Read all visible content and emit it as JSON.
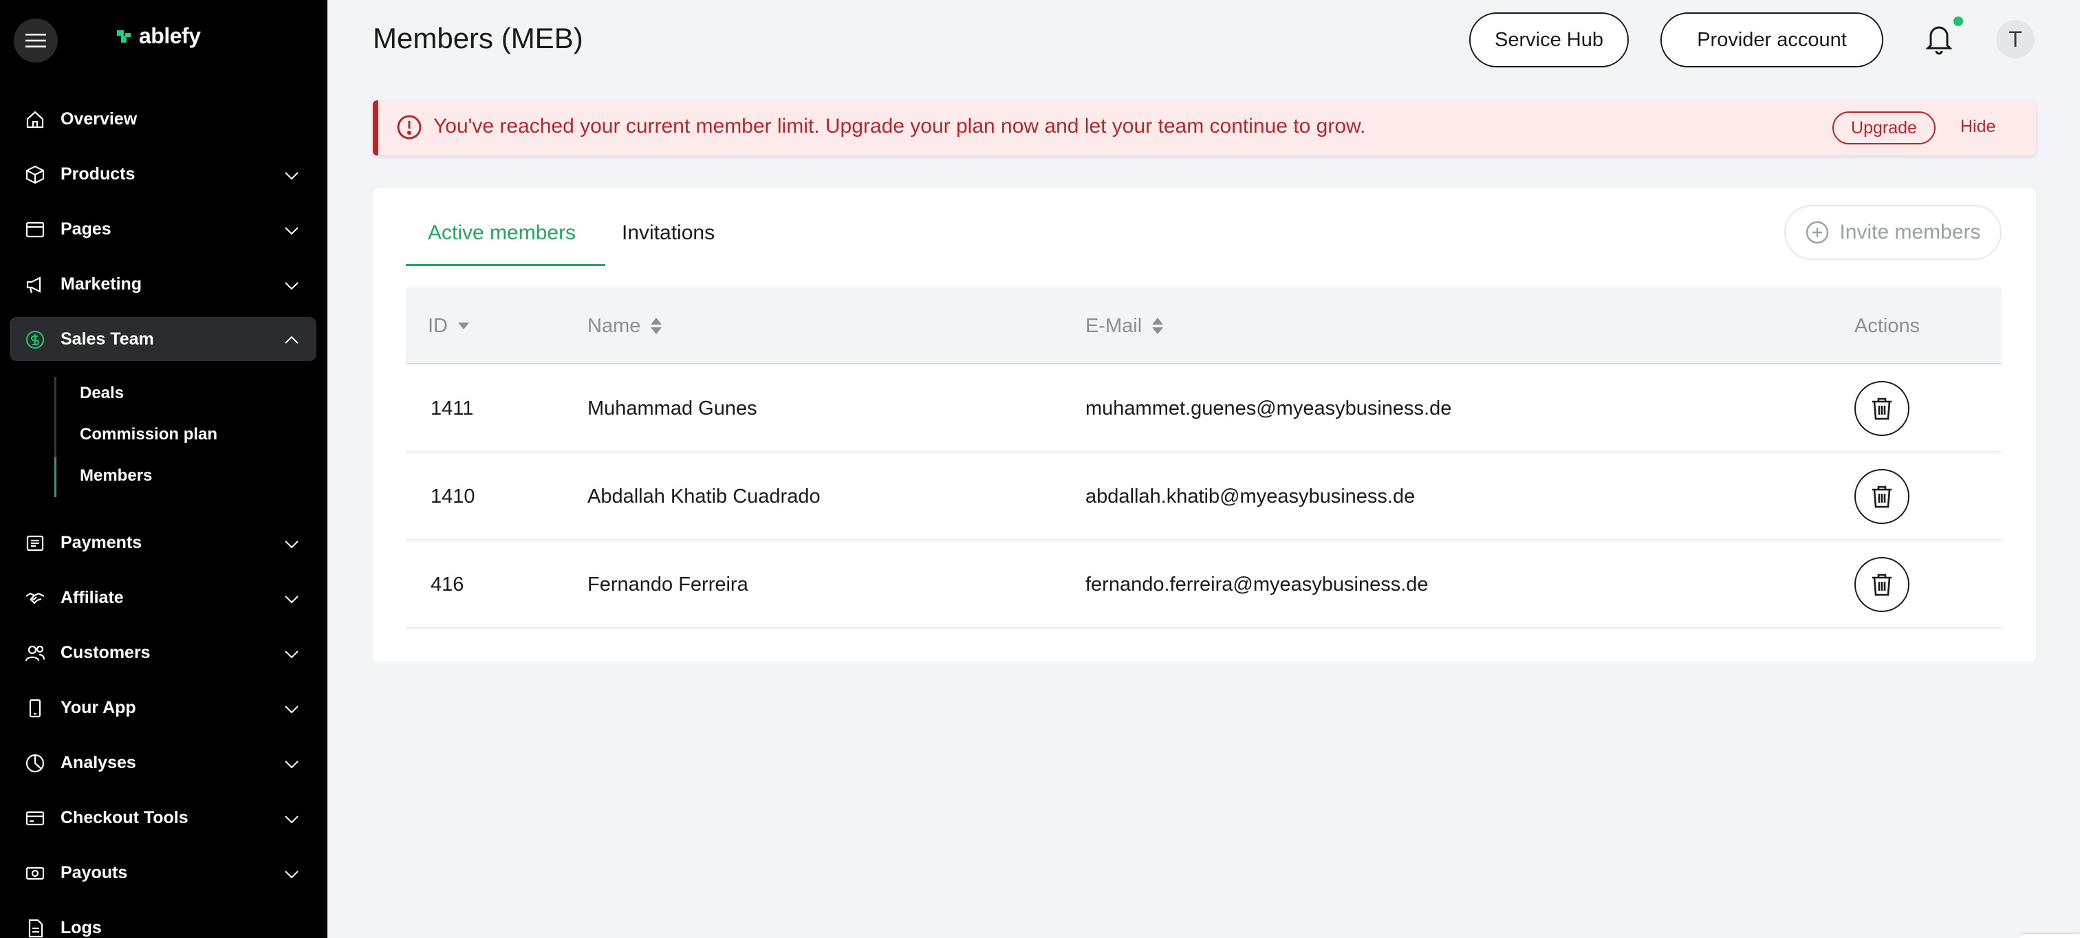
{
  "brand": {
    "name": "ablefy",
    "accent": "#21a665"
  },
  "sidebar": {
    "items": [
      {
        "label": "Overview",
        "icon": "home-icon"
      },
      {
        "label": "Products",
        "icon": "box-icon"
      },
      {
        "label": "Pages",
        "icon": "page-icon"
      },
      {
        "label": "Marketing",
        "icon": "megaphone-icon"
      },
      {
        "label": "Sales Team",
        "icon": "dollar-circle-icon"
      },
      {
        "label": "Payments",
        "icon": "receipt-icon"
      },
      {
        "label": "Affiliate",
        "icon": "handshake-icon"
      },
      {
        "label": "Customers",
        "icon": "users-icon"
      },
      {
        "label": "Your App",
        "icon": "phone-icon"
      },
      {
        "label": "Analyses",
        "icon": "pie-chart-icon"
      },
      {
        "label": "Checkout Tools",
        "icon": "cart-icon"
      },
      {
        "label": "Payouts",
        "icon": "cash-icon"
      },
      {
        "label": "Logs",
        "icon": "file-icon"
      }
    ],
    "sales_team_sub": [
      "Deals",
      "Commission plan",
      "Members"
    ]
  },
  "header": {
    "title": "Members (MEB)",
    "service_hub": "Service Hub",
    "provider_account": "Provider account",
    "avatar_initial": "T"
  },
  "alert": {
    "message": "You've reached your current member limit. Upgrade your plan now and let your team continue to grow.",
    "upgrade": "Upgrade",
    "hide": "Hide"
  },
  "tabs": {
    "active": "Active members",
    "invitations": "Invitations"
  },
  "invite_button": "Invite members",
  "table": {
    "headers": {
      "id": "ID",
      "name": "Name",
      "email": "E-Mail",
      "actions": "Actions"
    },
    "rows": [
      {
        "id": "1411",
        "name": "Muhammad Gunes",
        "email": "muhammet.guenes@myeasybusiness.de"
      },
      {
        "id": "1410",
        "name": "Abdallah Khatib Cuadrado",
        "email": "abdallah.khatib@myeasybusiness.de"
      },
      {
        "id": "416",
        "name": "Fernando Ferreira",
        "email": "fernando.ferreira@myeasybusiness.de"
      }
    ]
  }
}
